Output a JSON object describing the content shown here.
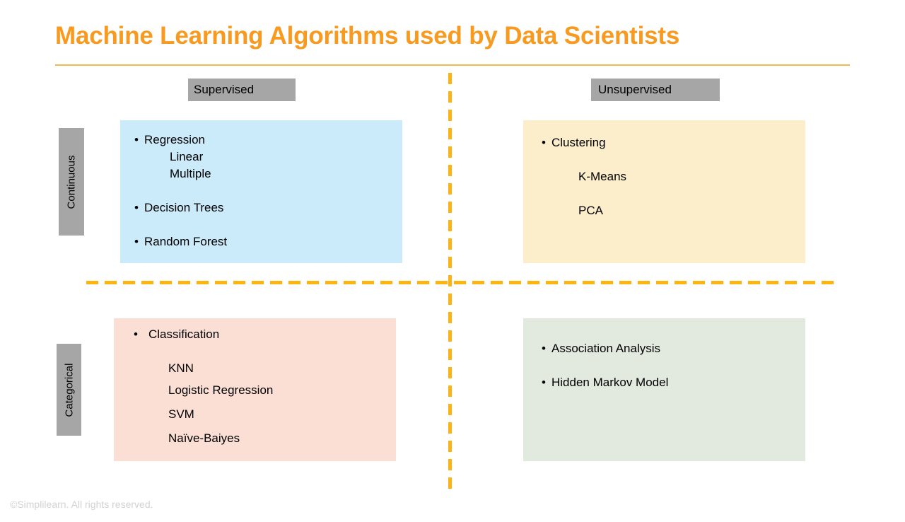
{
  "slide": {
    "title": "Machine Learning Algorithms used by Data Scientists",
    "footer": "©Simplilearn. All rights reserved.",
    "accent_color": "#F79A1F",
    "rule_color": "#F0B94E",
    "divider_color": "#FAB514",
    "tab_color": "#A6A6A6"
  },
  "columns": [
    {
      "key": "supervised",
      "label": "Supervised"
    },
    {
      "key": "unsupervised",
      "label": "Unsupervised"
    }
  ],
  "rows": [
    {
      "key": "continuous",
      "label": "Continuous"
    },
    {
      "key": "categorical",
      "label": "Categorical"
    }
  ],
  "quadrants": {
    "supervised_continuous": {
      "background": "#CCEBFA",
      "items": [
        {
          "bullet": "•",
          "text": "Regression"
        },
        {
          "sub": "Linear"
        },
        {
          "sub": "Multiple"
        },
        {
          "bullet": "•",
          "text": "Decision Trees"
        },
        {
          "bullet": "•",
          "text": "Random Forest"
        }
      ]
    },
    "unsupervised_continuous": {
      "background": "#FCEECB",
      "items": [
        {
          "bullet": "•",
          "text": "Clustering"
        },
        {
          "sub": "K-Means"
        },
        {
          "sub": "PCA"
        }
      ]
    },
    "supervised_categorical": {
      "background": "#FBDFD5",
      "items": [
        {
          "bullet": "•",
          "text": "Classification"
        },
        {
          "sub": "KNN"
        },
        {
          "sub": "Logistic Regression"
        },
        {
          "sub": "SVM"
        },
        {
          "sub": "Naïve-Baiyes"
        }
      ]
    },
    "unsupervised_categorical": {
      "background": "#E2E9DF",
      "items": [
        {
          "bullet": "•",
          "text": "Association Analysis"
        },
        {
          "bullet": "•",
          "text": "Hidden Markov Model"
        }
      ]
    }
  }
}
